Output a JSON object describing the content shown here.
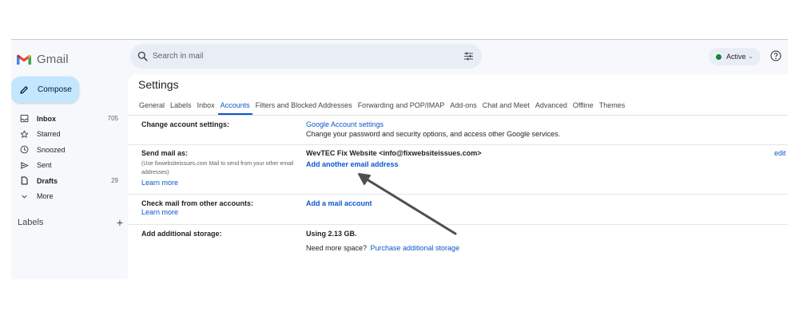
{
  "app": {
    "name": "Gmail"
  },
  "compose": {
    "label": "Compose"
  },
  "nav": [
    {
      "label": "Inbox",
      "count": "705",
      "icon": "inbox-icon",
      "bold": true
    },
    {
      "label": "Starred",
      "count": "",
      "icon": "star-icon",
      "bold": false
    },
    {
      "label": "Snoozed",
      "count": "",
      "icon": "clock-icon",
      "bold": false
    },
    {
      "label": "Sent",
      "count": "",
      "icon": "send-icon",
      "bold": false
    },
    {
      "label": "Drafts",
      "count": "29",
      "icon": "draft-icon",
      "bold": true
    },
    {
      "label": "More",
      "count": "",
      "icon": "chevron-down-icon",
      "bold": false
    }
  ],
  "labels_section": {
    "title": "Labels",
    "add": "+"
  },
  "search": {
    "placeholder": "Search in mail"
  },
  "status": {
    "label": "Active",
    "color": "#188038"
  },
  "settings": {
    "title": "Settings",
    "tabs": [
      "General",
      "Labels",
      "Inbox",
      "Accounts",
      "Filters and Blocked Addresses",
      "Forwarding and POP/IMAP",
      "Add-ons",
      "Chat and Meet",
      "Advanced",
      "Offline",
      "Themes"
    ],
    "active_tab": "Accounts",
    "rows": {
      "change": {
        "title": "Change account settings:",
        "link": "Google Account settings",
        "desc": "Change your password and security options, and access other Google services."
      },
      "send": {
        "title": "Send mail as:",
        "note": "(Use fixwebsiteissues.com Mail to send from your other email addresses)",
        "learn": "Learn more",
        "identity": "WevTEC Fix Website <info@fixwebsiteissues.com>",
        "add": "Add another email address",
        "edit": "edit i"
      },
      "check": {
        "title": "Check mail from other accounts:",
        "learn": "Learn more",
        "add": "Add a mail account"
      },
      "storage": {
        "title": "Add additional storage:",
        "using": "Using 2.13 GB.",
        "need": "Need more space?",
        "purchase": "Purchase additional storage"
      }
    }
  },
  "colors": {
    "accent": "#0b57d0",
    "compose_bg": "#c2e7ff",
    "shell_bg": "#f6f8fc"
  }
}
